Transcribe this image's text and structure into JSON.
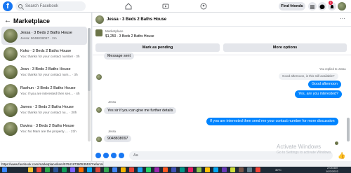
{
  "topbar": {
    "logo": "f",
    "search_placeholder": "Search Facebook",
    "find_friends": "Find friends",
    "notification_count": "1"
  },
  "sidebar": {
    "title": "Marketplace",
    "threads": [
      {
        "name": "Jessa · 3 Beds 2 Baths House",
        "preview": "Jessa: 9048838097 · 2m"
      },
      {
        "name": "Koko · 3 Beds 2 Baths House",
        "preview": "You: thanks for your contact number · 3h"
      },
      {
        "name": "Jean · 3 Beds 2 Baths House",
        "preview": "You: thanks for your contact num... · 3h"
      },
      {
        "name": "Rashun · 3 Beds 2 Baths House",
        "preview": "You: If you are interested then sen... · 4h"
      },
      {
        "name": "James · 3 Beds 2 Baths House",
        "preview": "You: thanks for your contact nu... · 20h"
      },
      {
        "name": "Davina · 3 Beds 2 Baths House",
        "preview": "You: No Mam are the property ... · 21h"
      }
    ]
  },
  "chat": {
    "title": "Jessa · 3 Beds 2 Baths House",
    "listing_label": "Marketplace",
    "listing_price": "$1,250 · 3 Beds 2 Baths House",
    "mark_pending": "Mark as pending",
    "more_options": "More options",
    "messages": {
      "m1": "Message sent",
      "replied_label": "You replied to Jessa",
      "quote": "Good afternoon, is this still available?",
      "out1": "Good afternoon",
      "out2": "Yes, are you interested?",
      "sender1": "Jessa",
      "in1": "Yes sir if you can give me further details",
      "out3": "If you are interested then send me your contact number for more discussion",
      "sender2": "Jessa",
      "in2": "9048838097"
    },
    "composer_placeholder": "Aa",
    "like_icon": "thumbs-up-icon"
  },
  "watermark": {
    "line1": "Activate Windows",
    "line2": "Go to Settings to activate Windows."
  },
  "status_url": "https://www.facebook.com/marketplace/item/579418738053553/?referralSurface=...",
  "taskbar": {
    "temp": "30°C",
    "time": "2:04 AM",
    "date": "10/2/2022"
  },
  "colors": {
    "accent": "#1877f2",
    "outgoing_bubble": "#0084ff",
    "incoming_bubble": "#e4e6eb"
  }
}
